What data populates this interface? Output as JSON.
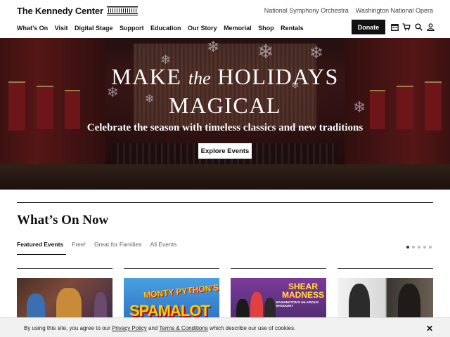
{
  "header": {
    "logo_text": "The Kennedy Center",
    "utility_links": [
      "National Symphony Orchestra",
      "Washington National Opera"
    ],
    "nav": [
      "What’s On",
      "Visit",
      "Digital Stage",
      "Support",
      "Education",
      "Our Story",
      "Memorial",
      "Shop",
      "Rentals"
    ],
    "donate_label": "Donate",
    "icons": [
      "calendar-icon",
      "cart-icon",
      "search-icon",
      "user-icon"
    ]
  },
  "hero": {
    "title_line1_a": "MAKE",
    "title_line1_b": "the",
    "title_line1_c": "HOLIDAYS",
    "title_line2": "MAGICAL",
    "subtitle": "Celebrate the season with timeless classics and new traditions",
    "cta_label": "Explore Events"
  },
  "whats_on": {
    "title": "What’s On Now",
    "tabs": [
      "Featured Events",
      "Free!",
      "Great for Families",
      "All Events"
    ],
    "active_tab": 0,
    "carousel_dots": 5,
    "active_dot": 0,
    "cards": [
      {
        "image": "opera-scene"
      },
      {
        "image": "spamalot-poster",
        "poster_top": "MONTY PYTHON'S",
        "poster_main": "SPAMALOT"
      },
      {
        "image": "shear-madness-poster",
        "poster_main": "SHEAR MADNESS",
        "poster_sub": "WASHINGTON'S HILARIOUS WHODUNIT"
      },
      {
        "image": "musicians-portraits"
      }
    ]
  },
  "cookie": {
    "text_before": "By using this site, you agree to our ",
    "privacy_label": "Privacy Policy",
    "text_mid": " and ",
    "terms_label": "Terms & Conditions",
    "text_after": " which describe our use of cookies.",
    "close_label": "✕"
  },
  "colors": {
    "hero_dark": "#2a1212",
    "accent_red": "#8b1a1f",
    "black": "#111111",
    "cookie_bg": "#f1f1f1"
  }
}
